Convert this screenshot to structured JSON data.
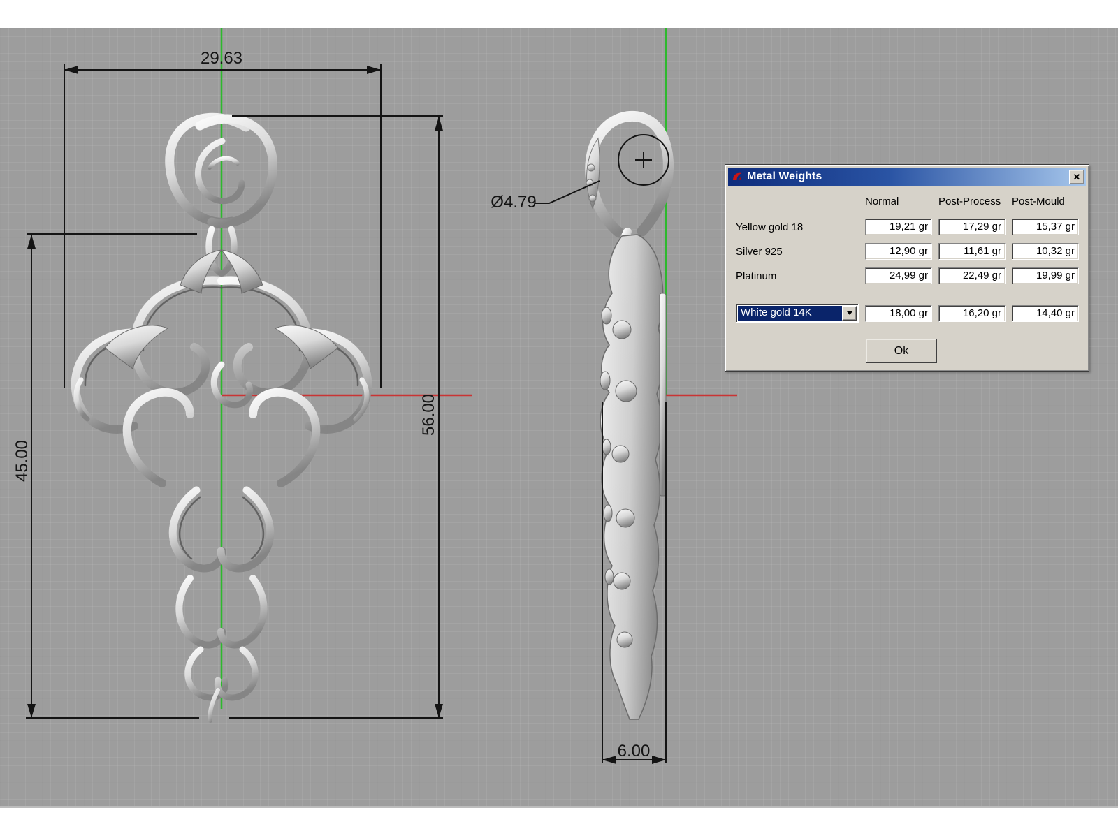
{
  "colors": {
    "viewport_bg": "#9d9d9d",
    "axis_green": "#2db92d",
    "axis_red": "#c93434",
    "dimension_color": "#141414",
    "dialog_face": "#d6d2c9",
    "titlebar_gradient_start": "#0e2c7c",
    "titlebar_gradient_end": "#a7c7ec",
    "dropdown_selected_bg": "#0a246a"
  },
  "annotations": {
    "front_width": "29.63",
    "front_inner_height": "45.00",
    "front_total_height": "56.00",
    "bail_hole_diameter": "Ø4.79",
    "side_thickness": "6.00"
  },
  "dialog": {
    "title": "Metal Weights",
    "title_icon": "rhino-logo-icon",
    "close_icon": "✕",
    "columns": [
      "Normal",
      "Post-Process",
      "Post-Mould"
    ],
    "rows": [
      {
        "label": "Yellow gold 18",
        "normal": "19,21 gr",
        "post_process": "17,29 gr",
        "post_mould": "15,37 gr"
      },
      {
        "label": "Silver 925",
        "normal": "12,90 gr",
        "post_process": "11,61 gr",
        "post_mould": "10,32 gr"
      },
      {
        "label": "Platinum",
        "normal": "24,99 gr",
        "post_process": "22,49 gr",
        "post_mould": "19,99 gr"
      }
    ],
    "custom_metal": {
      "selected": "White gold 14K",
      "normal": "18,00 gr",
      "post_process": "16,20 gr",
      "post_mould": "14,40 gr"
    },
    "ok": {
      "initial": "O",
      "rest": "k"
    }
  }
}
